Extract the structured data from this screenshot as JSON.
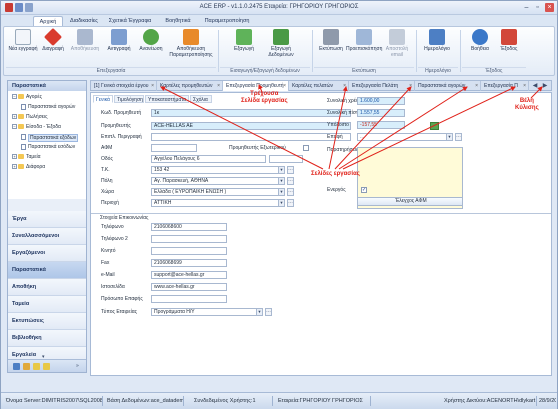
{
  "window": {
    "title": "ACE ERP - v1.1.0.2475 Εταιρεία: ΓΡΗΓΟΡΙΟΥ ΓΡΗΓΟΡΙΟΣ"
  },
  "ribbon": {
    "tabs": [
      "Αρχική",
      "Διαδικασίες",
      "Σχετικά Έγγραφα",
      "Βοηθητικά",
      "Παραμετροποίηση"
    ],
    "buttons": {
      "new": "Νέα εγγραφή",
      "delete": "Διαγραφή",
      "save": "Αποθήκευση",
      "copy": "Αντιγραφή",
      "refresh": "Ανανέωση",
      "save_params": "Αποθήκευση Παραμετροποίησης",
      "export": "Εξαγωγή",
      "export_data": "Εξαγωγή Δεδομένων",
      "print": "Εκτύπωση",
      "preview": "Προεπισκόπηση",
      "send_email": "Αποστολή email",
      "calendar": "Ημερολόγιο",
      "help": "Βοήθεια",
      "exit": "Έξοδος"
    },
    "groups": {
      "edit": "Επεξεργασία",
      "export": "Εισαγωγή/Εξαγωγή δεδομένων",
      "print": "Εκτύπωση",
      "calendar": "Ημερολόγιο",
      "exit": "Έξοδος"
    }
  },
  "sidebar": {
    "header": "Παραστατικά",
    "tree": [
      {
        "label": "Αγορές",
        "level": 0,
        "type": "folder",
        "exp": "−"
      },
      {
        "label": "Παραστατικά αγορών",
        "level": 1,
        "type": "doc"
      },
      {
        "label": "Πωλήσεις",
        "level": 0,
        "type": "folder",
        "exp": "+"
      },
      {
        "label": "Είσοδα - Έξοδα",
        "level": 0,
        "type": "folder",
        "exp": "−"
      },
      {
        "label": "Παραστατικά εξόδων",
        "level": 1,
        "type": "doc",
        "selected": true
      },
      {
        "label": "Παραστατικά εσόδων",
        "level": 1,
        "type": "doc"
      },
      {
        "label": "Ταμεία",
        "level": 0,
        "type": "folder",
        "exp": "+"
      },
      {
        "label": "Διάφορα",
        "level": 0,
        "type": "folder",
        "exp": "+"
      }
    ],
    "nav": [
      "Έργα",
      "Συναλλασσόμενοι",
      "Εργαζόμενοι",
      "Παραστατικά",
      "Αποθήκη",
      "Ταμεία",
      "Εκτυπώσεις",
      "Βιβλιοθήκη",
      "Εργαλεία"
    ],
    "nav_active": "Παραστατικά"
  },
  "doc_tabs": [
    {
      "label": "[1] Γενικά στοιχεία έργου",
      "active": false
    },
    {
      "label": "Καρτέλες προμηθευτών",
      "active": false
    },
    {
      "label": "Επεξεργασία Προμηθευτή",
      "active": true
    },
    {
      "label": "Καρτέλες πελατών",
      "active": false
    },
    {
      "label": "Επεξεργασία Πελάτη",
      "active": false
    },
    {
      "label": "Παραστατικά αγορών",
      "active": false
    },
    {
      "label": "Επεξεργασία Π",
      "active": false
    }
  ],
  "form": {
    "subtabs": [
      "Γενικά",
      "Τιμολόγηση",
      "Υποκαταστήματα",
      "Σχόλια"
    ],
    "left": {
      "code": {
        "label": "Κωδ. Προμηθευτή",
        "value": "1κ"
      },
      "supplier": {
        "label": "Προμηθευτής",
        "value": "ACE-HELLAS AE"
      },
      "extra": {
        "label": "Επιπλ. Περιγραφή",
        "value": ""
      },
      "afm": {
        "label": "ΑΦΜ",
        "value": ""
      },
      "foreign": {
        "label": "Προμηθευτής Εξωτερικού"
      },
      "street": {
        "label": "Οδός",
        "value": "Αγγέλου Πελάγους 6"
      },
      "tk": {
        "label": "Τ.Κ.",
        "value": "153 42"
      },
      "city": {
        "label": "Πόλη",
        "value": "Αγ. Παρασκευή, ΑΘΗΝΑ"
      },
      "country": {
        "label": "Χώρα",
        "value": "Ελλάδα ( ΕΥΡΩΠΑΪΚΗ ΕΝΩΣΗ )"
      },
      "region": {
        "label": "Περιοχή",
        "value": "ΑΤΤΙΚΗ"
      }
    },
    "right": {
      "debit": {
        "label": "Συνολική χρέωση",
        "value": "1.600,00"
      },
      "credit": {
        "label": "Συνολική πίστωση",
        "value": "1.557,55"
      },
      "balance": {
        "label": "Υπόλοιπο",
        "value": "-157,55"
      },
      "contact": {
        "label": "Επαφή",
        "value": "..."
      },
      "notes": {
        "label": "Παρατηρήσεις"
      },
      "active": {
        "label": "Ενεργός",
        "value": "✓"
      },
      "afm_button": "Έλεγχος ΑΦΜ"
    },
    "contact_section": {
      "title": "Στοιχεία Επικοινωνίας",
      "phone1": {
        "label": "Τηλέφωνο",
        "value": "2106068600"
      },
      "phone2": {
        "label": "Τηλέφωνο 2",
        "value": ""
      },
      "mobile": {
        "label": "Κινητό",
        "value": ""
      },
      "fax": {
        "label": "Fax",
        "value": "2106068699"
      },
      "email": {
        "label": "e-Mail",
        "value": "support@ace-hellas.gr"
      },
      "website": {
        "label": "Ιστοσελίδα",
        "value": "www.ace-hellas.gr"
      },
      "contact_person": {
        "label": "Πρόσωπο Επαφής",
        "value": ""
      },
      "company_type": {
        "label": "Τύπος Εταιρείας",
        "value": "Προγράμματα Η/Υ"
      }
    }
  },
  "annotations": {
    "current_page": "Τρέχουσα\nΣελίδα εργασίας",
    "work_pages": "Σελίδες εργασίας",
    "arrows": "Βέλη\nΚύλισης"
  },
  "status": [
    "Όνομα Server:DIMITRIS2007\\SQL2008",
    "Βάση Δεδομένων:ace_datademo7",
    "Συνδεδεμένος Χρήστης:1",
    "Εταιρεία:ΓΡΗΓΟΡΙΟΥ ΓΡΗΓΟΡΙΟΣ",
    "Χρήστης Δικτύου:ACENORTH\\dlykart",
    "28/9/2012"
  ],
  "colors": {
    "annotation": "#e0221a",
    "accent": "#1a56a8",
    "field_blue": "#d8eefb",
    "field_yellow": "#fffbd8"
  }
}
